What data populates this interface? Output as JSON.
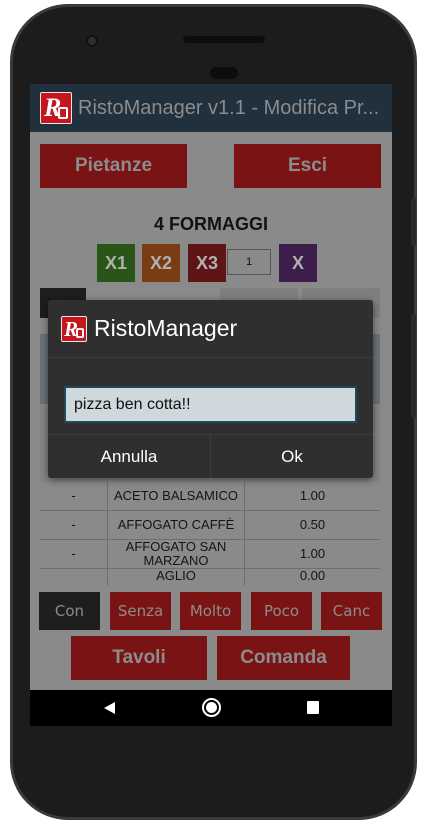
{
  "app": {
    "title": "RistoManager v1.1 - Modifica Pr..."
  },
  "top_buttons": {
    "pietanze": "Pietanze",
    "esci": "Esci"
  },
  "dish": {
    "name": "4 FORMAGGI"
  },
  "quantity": {
    "x1": "X1",
    "x2": "X2",
    "x3": "X3",
    "value": "1",
    "clear": "X"
  },
  "table": {
    "rows": [
      {
        "mark": "-",
        "name": "ACETO BALSAMICO",
        "price": "1.00"
      },
      {
        "mark": "-",
        "name": "AFFOGATO CAFFÈ",
        "price": "0.50"
      },
      {
        "mark": "-",
        "name": "AFFOGATO SAN MARZANO",
        "price": "1.00"
      },
      {
        "mark": "",
        "name": "AGLIO",
        "price": "0.00"
      }
    ]
  },
  "modifiers": {
    "con": "Con",
    "senza": "Senza",
    "molto": "Molto",
    "poco": "Poco",
    "canc": "Canc"
  },
  "bottom_buttons": {
    "tavoli": "Tavoli",
    "comanda": "Comanda"
  },
  "dialog": {
    "title": "RistoManager",
    "input_value": "pizza ben cotta!!",
    "cancel_label": "Annulla",
    "ok_label": "Ok"
  },
  "colors": {
    "accent_red": "#c4161c",
    "x1_green": "#3d8b25",
    "x2_orange": "#b5561a",
    "x3_red": "#8d1c1c",
    "x_purple": "#5b2a70"
  },
  "icons": {
    "back": "back-icon",
    "home": "home-icon",
    "recent": "recent-apps-icon",
    "logo": "ristomanager-logo-icon"
  }
}
